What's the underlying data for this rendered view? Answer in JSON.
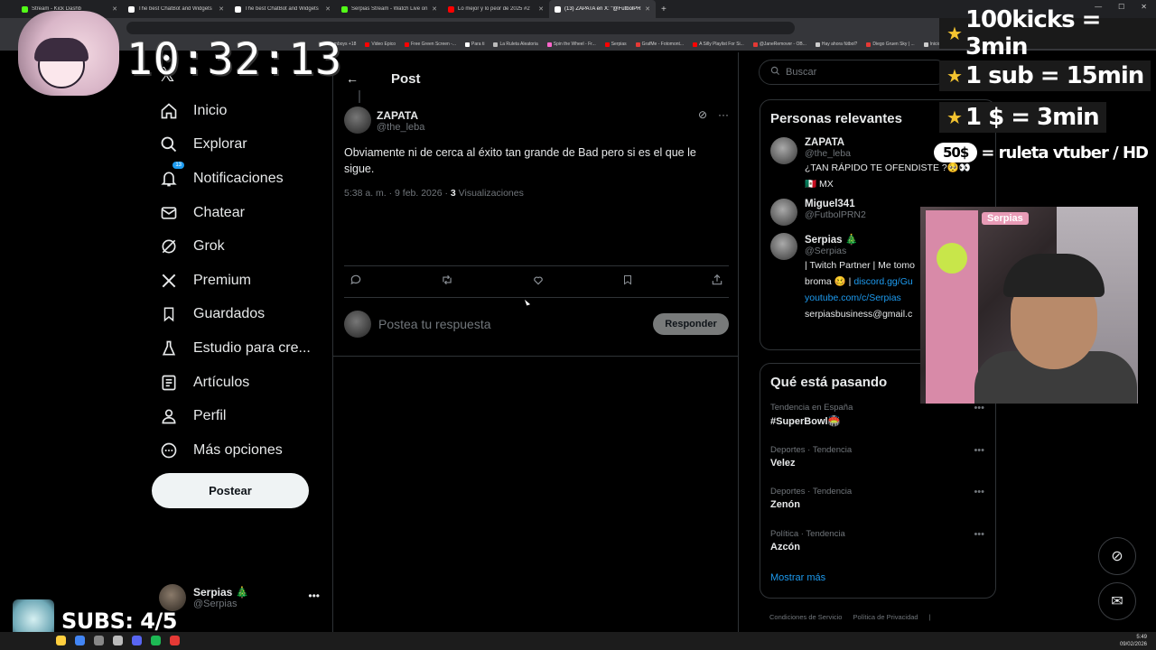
{
  "browser": {
    "tabs": [
      {
        "title": "Stream - Kick Dashb",
        "color": "#53fc18",
        "active": false
      },
      {
        "title": "The best ChatBot and Widgets",
        "color": "#ffffff",
        "active": false
      },
      {
        "title": "The best ChatBot and Widgets",
        "color": "#ffffff",
        "active": false
      },
      {
        "title": "Serpias Stream - Watch Live on",
        "color": "#53fc18",
        "active": false
      },
      {
        "title": "Lo mejor y lo peor de 2025 #2",
        "color": "#ff0000",
        "active": false
      },
      {
        "title": "(13) ZAPATA en X: \"@FutbolPR",
        "color": "#ffffff",
        "active": true
      }
    ],
    "bookmarks": [
      {
        "label": "amboys +18",
        "color": "#999999"
      },
      {
        "label": "Video Epico",
        "color": "#ff0000"
      },
      {
        "label": "Free Green Screen -...",
        "color": "#ff0000"
      },
      {
        "label": "Para ti",
        "color": "#ffffff"
      },
      {
        "label": "La Ruleta Aleatoria",
        "color": "#bbbbbb"
      },
      {
        "label": "Spin the Wheel - Fr...",
        "color": "#ff66cc"
      },
      {
        "label": "Serpias",
        "color": "#ff0000"
      },
      {
        "label": "GrafMe - Fotomont...",
        "color": "#e53935"
      },
      {
        "label": "A Silly Playlist For Si...",
        "color": "#ff0000"
      },
      {
        "label": "@JaneRemover - OB...",
        "color": "#e53935"
      },
      {
        "label": "Hay ahora fútbol?",
        "color": "#cccccc"
      },
      {
        "label": "Diego Gruen Sky | ...",
        "color": "#e53935"
      },
      {
        "label": "Inicio servicio",
        "color": "#cccccc"
      }
    ]
  },
  "nav": {
    "items": [
      {
        "label": "Inicio",
        "icon": "home-icon"
      },
      {
        "label": "Explorar",
        "icon": "search-icon"
      },
      {
        "label": "Notificaciones",
        "icon": "bell-icon",
        "badge": "13"
      },
      {
        "label": "Chatear",
        "icon": "mail-icon"
      },
      {
        "label": "Grok",
        "icon": "grok-icon"
      },
      {
        "label": "Premium",
        "icon": "x-logo-icon"
      },
      {
        "label": "Guardados",
        "icon": "bookmark-icon"
      },
      {
        "label": "Estudio para cre...",
        "icon": "flask-icon"
      },
      {
        "label": "Artículos",
        "icon": "article-icon"
      },
      {
        "label": "Perfil",
        "icon": "person-icon"
      },
      {
        "label": "Más opciones",
        "icon": "more-circle-icon"
      }
    ],
    "post_button": "Postear",
    "account": {
      "name": "Serpias 🎄",
      "handle": "@Serpias"
    }
  },
  "post": {
    "header_title": "Post",
    "author_name": "ZAPATA",
    "author_handle": "@the_leba",
    "text": "Obviamente ni de cerca al éxito tan grande de Bad pero si es el que le sigue.",
    "time": "5:38 a. m. · 9 feb. 2026 · ",
    "views_count": "3",
    "views_label": " Visualizaciones",
    "reply_placeholder": "Postea tu respuesta",
    "reply_button": "Responder"
  },
  "search": {
    "placeholder": "Buscar"
  },
  "relevant": {
    "title": "Personas relevantes",
    "people": [
      {
        "name": "ZAPATA",
        "handle": "@the_leba",
        "bio": "¿TAN RÁPIDO TE OFENDISTE ?🥺👀",
        "bio2": "🇲🇽 MX",
        "link1": "",
        "link2": "",
        "extra": ""
      },
      {
        "name": "Miguel341",
        "handle": "@FutbolPRN2",
        "bio": "",
        "bio2": "",
        "link1": "",
        "link2": "",
        "extra": ""
      },
      {
        "name": "Serpias 🎄",
        "handle": "@Serpias",
        "bio": "| Twitch Partner | Me tomo",
        "bio2": "broma 🥴 |",
        "link1": "discord.gg/Gu",
        "link2": "youtube.com/c/Serpias",
        "extra": "serpiasbusiness@gmail.c"
      }
    ]
  },
  "trends": {
    "title": "Qué está pasando",
    "items": [
      {
        "category": "Tendencia en España",
        "name": "#SuperBowl🏟️"
      },
      {
        "category": "Deportes · Tendencia",
        "name": "Velez"
      },
      {
        "category": "Deportes · Tendencia",
        "name": "Zenón"
      },
      {
        "category": "Política · Tendencia",
        "name": "Azcón"
      }
    ],
    "show_more": "Mostrar más"
  },
  "footer": {
    "links": [
      "Condiciones de Servicio",
      "Política de Privacidad",
      "|"
    ]
  },
  "overlay": {
    "timer": "10:32:13",
    "goals": [
      "100kicks = 3min",
      "1 sub = 15min",
      "1 $ = 3min"
    ],
    "goal4_pill": "50$",
    "goal4_text": "= ruleta vtuber / HD",
    "webcam_label": "Serpias",
    "subs": "SUBS: 4/5"
  },
  "taskbar": {
    "time": "5:49",
    "date": "09/02/2026"
  }
}
